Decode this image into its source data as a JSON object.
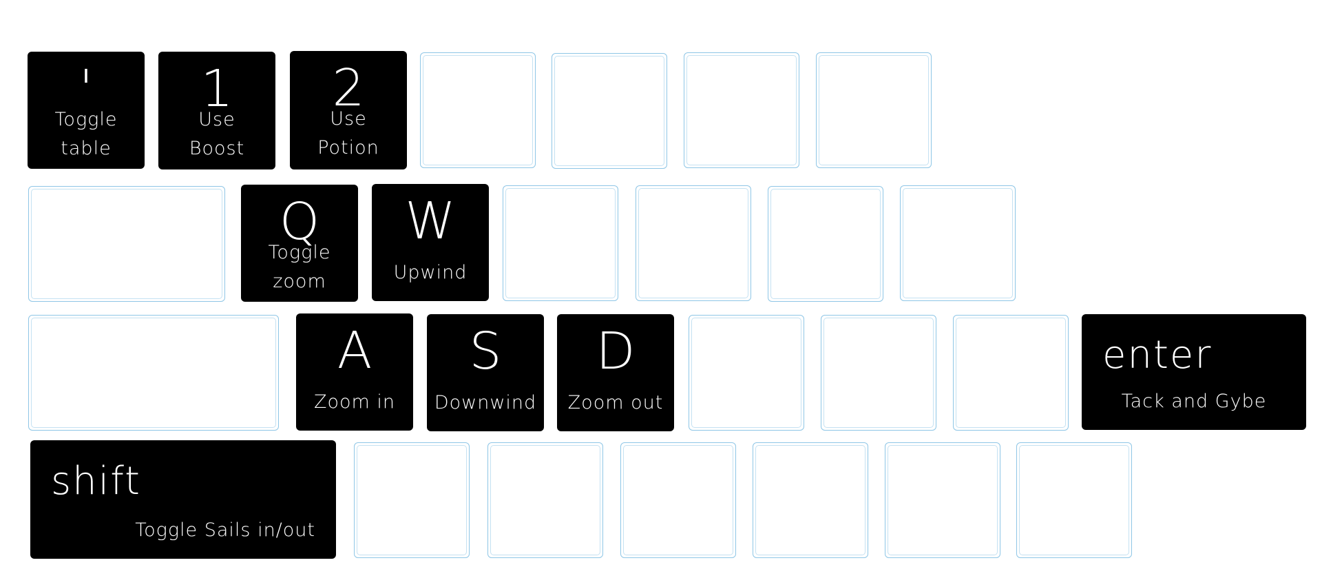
{
  "keyboard": {
    "row1": {
      "apostrophe": {
        "glyph": "'",
        "action": [
          "Toggle",
          "table"
        ]
      },
      "one": {
        "glyph": "1",
        "action": [
          "Use",
          "Boost"
        ]
      },
      "two": {
        "glyph": "2",
        "action": [
          "Use",
          "Potion"
        ]
      }
    },
    "row2": {
      "q": {
        "glyph": "Q",
        "action": [
          "Toggle",
          "zoom"
        ]
      },
      "w": {
        "glyph": "W",
        "action": [
          "Upwind"
        ]
      }
    },
    "row3": {
      "a": {
        "glyph": "A",
        "action": [
          "Zoom in"
        ]
      },
      "s": {
        "glyph": "S",
        "action": [
          "Downwind"
        ]
      },
      "d": {
        "glyph": "D",
        "action": [
          "Zoom out"
        ]
      },
      "enter": {
        "glyph": "enter",
        "action": [
          "Tack and Gybe"
        ]
      }
    },
    "row4": {
      "shift": {
        "glyph": "shift",
        "action": [
          "Toggle Sails in/out"
        ]
      }
    }
  },
  "colors": {
    "key_fill": "#000000",
    "key_text": "#ffffff",
    "empty_key_border": "#8ec6e6"
  }
}
